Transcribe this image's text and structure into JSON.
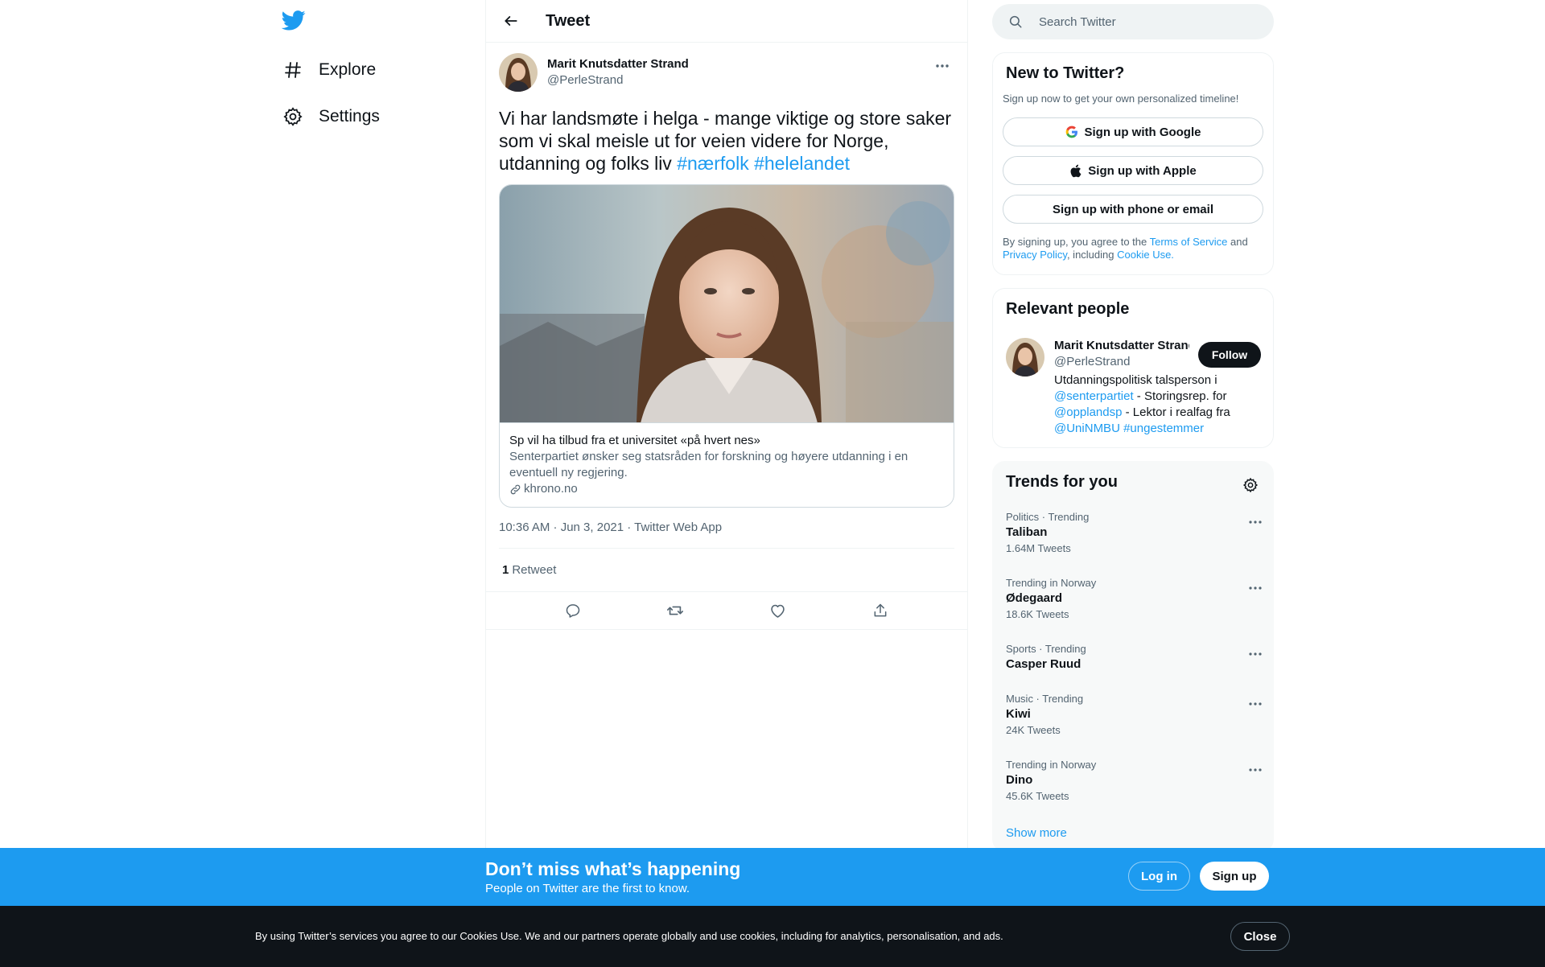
{
  "nav": {
    "items": [
      {
        "label": "Explore",
        "icon": "hashtag-icon"
      },
      {
        "label": "Settings",
        "icon": "gear-icon"
      }
    ]
  },
  "header": {
    "title": "Tweet"
  },
  "tweet": {
    "author_name": "Marit Knutsdatter Strand",
    "author_handle": "@PerleStrand",
    "text": "Vi har landsmøte i helga - mange viktige og store saker som vi skal meisle ut for veien videre for Norge, utdanning og folks liv ",
    "hashtags": [
      "#nærfolk",
      "#helelandet"
    ],
    "card": {
      "title": "Sp vil ha tilbud fra et universitet «på hvert nes»",
      "description": "Senterpartiet ønsker seg statsråden for forskning og høyere utdanning i en eventuell ny regjering.",
      "domain": "khrono.no"
    },
    "timestamp": "10:36 AM · Jun 3, 2021 · Twitter Web App",
    "retweet_count": "1",
    "retweet_label": "Retweet"
  },
  "search": {
    "placeholder": "Search Twitter"
  },
  "new_to_twitter": {
    "title": "New to Twitter?",
    "subtitle": "Sign up now to get your own personalized timeline!",
    "google": "Sign up with Google",
    "apple": "Sign up with Apple",
    "phone": "Sign up with phone or email",
    "legal_1": "By signing up, you agree to the ",
    "terms": "Terms of Service",
    "legal_2": " and ",
    "privacy": "Privacy Policy",
    "legal_3": ", including ",
    "cookie": "Cookie Use."
  },
  "relevant": {
    "title": "Relevant people",
    "name": "Marit Knutsdatter Strand",
    "handle": "@PerleStrand",
    "follow": "Follow",
    "bio_1": "Utdanningspolitisk talsperson i ",
    "mention_1": "@senterpartiet",
    "bio_2": " - Storingsrep. for ",
    "mention_2": "@opplandsp",
    "bio_3": " - Lektor i realfag fra ",
    "mention_3": "@UniNMBU",
    "bio_4": " ",
    "tag_1": "#ungestemmer"
  },
  "trends": {
    "title": "Trends for you",
    "items": [
      {
        "meta": "Politics · Trending",
        "name": "Taliban",
        "count": "1.64M Tweets"
      },
      {
        "meta": "Trending in Norway",
        "name": "Ødegaard",
        "count": "18.6K Tweets"
      },
      {
        "meta": "Sports · Trending",
        "name": "Casper Ruud",
        "count": ""
      },
      {
        "meta": "Music · Trending",
        "name": "Kiwi",
        "count": "24K Tweets"
      },
      {
        "meta": "Trending in Norway",
        "name": "Dino",
        "count": "45.6K Tweets"
      }
    ],
    "show_more": "Show more"
  },
  "signup_bar": {
    "title": "Don’t miss what’s happening",
    "subtitle": "People on Twitter are the first to know.",
    "login": "Log in",
    "signup": "Sign up"
  },
  "cookie_bar": {
    "text": "By using Twitter’s services you agree to our Cookies Use. We and our partners operate globally and use cookies, including for analytics, personalisation, and ads.",
    "close": "Close"
  },
  "colors": {
    "accent": "#1d9bf0",
    "text": "#0f1419",
    "secondary": "#536471",
    "dark": "#0f1419"
  }
}
